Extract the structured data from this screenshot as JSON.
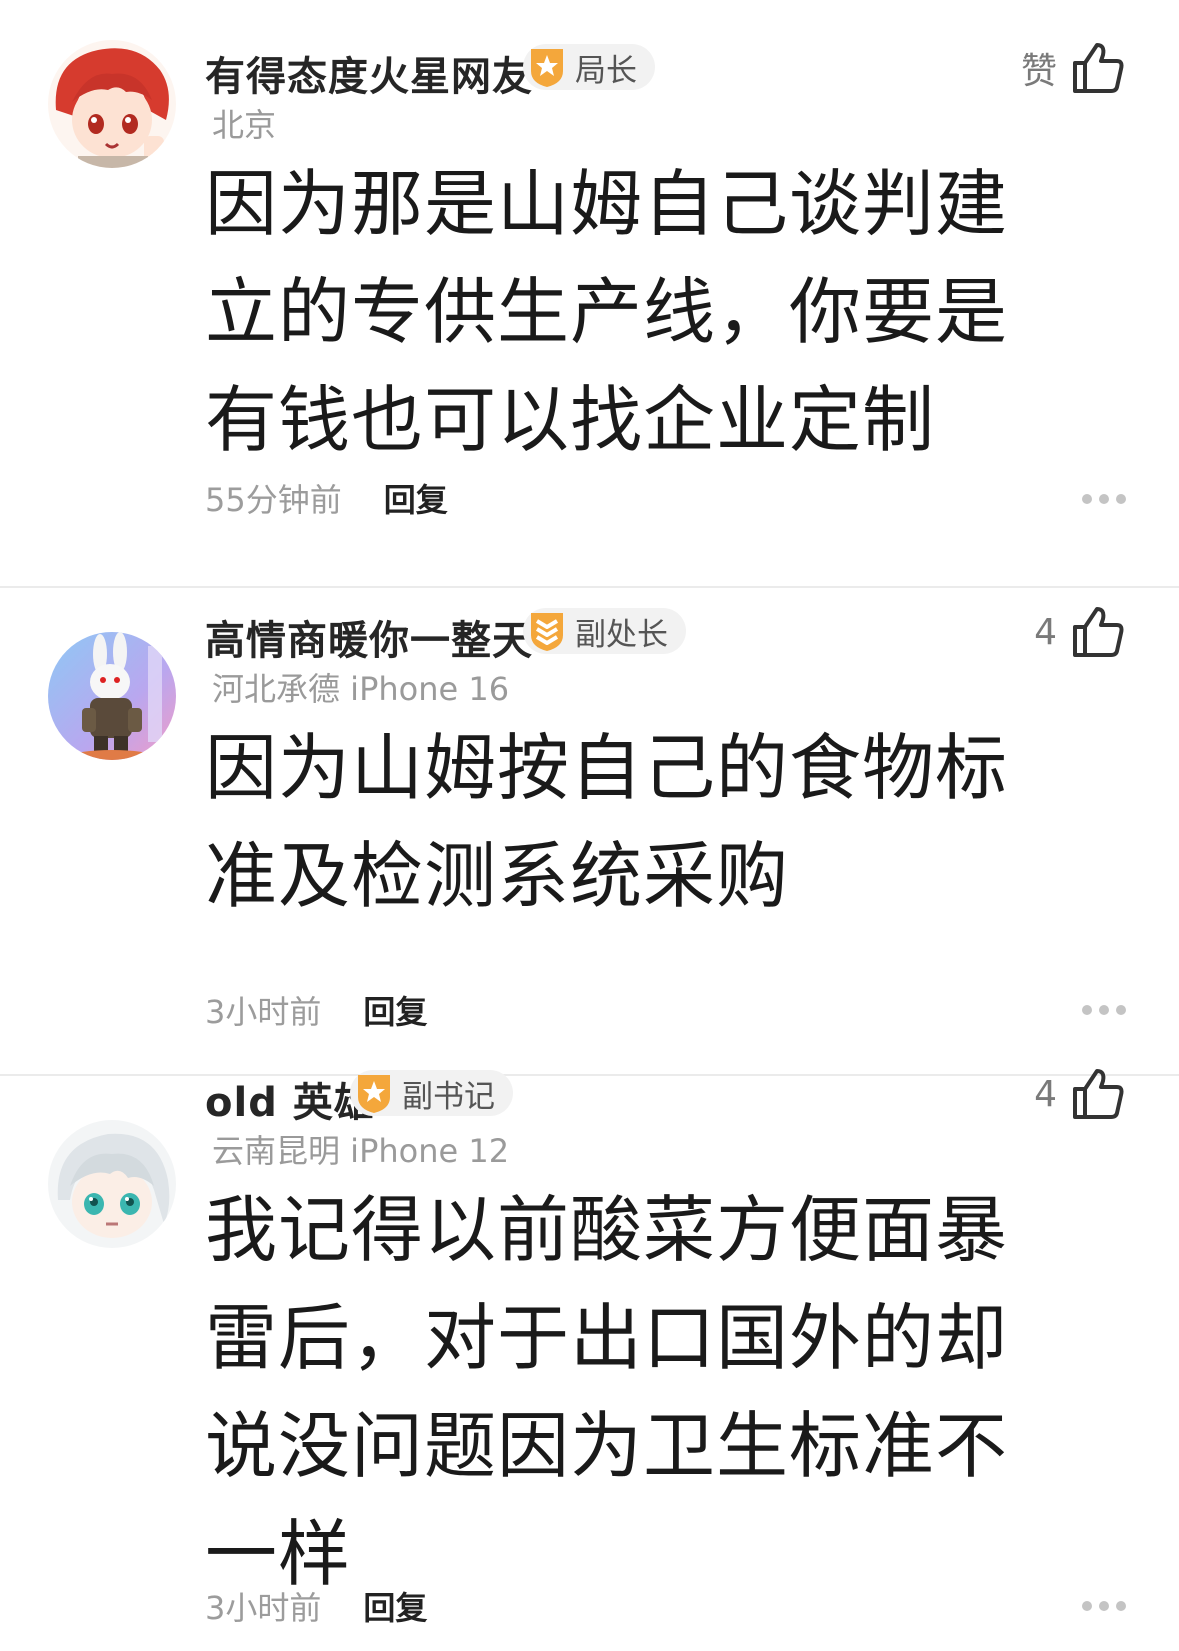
{
  "comments": [
    {
      "username": "有得态度火星网友",
      "badge": "局长",
      "location": "北京",
      "like_label": "赞",
      "text": "因为那是山姆自己谈判建立的专供生产线，你要是有钱也可以找企业定制",
      "time": "55分钟前",
      "reply_label": "回复"
    },
    {
      "username": "高情商暖你一整天",
      "badge": "副处长",
      "location": "河北承德 iPhone 16",
      "like_label": "4",
      "text": "因为山姆按自己的食物标准及检测系统采购",
      "time": "3小时前",
      "reply_label": "回复"
    },
    {
      "username": "old 英雄",
      "badge": "副书记",
      "location": "云南昆明 iPhone 12",
      "like_label": "4",
      "text": "我记得以前酸菜方便面暴雷后，对于出口国外的却说没问题因为卫生标准不一样",
      "time": "3小时前",
      "reply_label": "回复"
    }
  ],
  "icons": {
    "badge_1": "star-shield-badge-icon",
    "badge_2": "chevron-shield-badge-icon",
    "badge_3": "star-shield-badge-icon",
    "like": "thumbs-up-icon",
    "more": "more-dots-icon"
  },
  "colors": {
    "badge_orange": "#f4a73b",
    "text_primary": "#1a1a1a",
    "text_secondary": "#9a9a9a",
    "divider": "#ebebeb"
  }
}
